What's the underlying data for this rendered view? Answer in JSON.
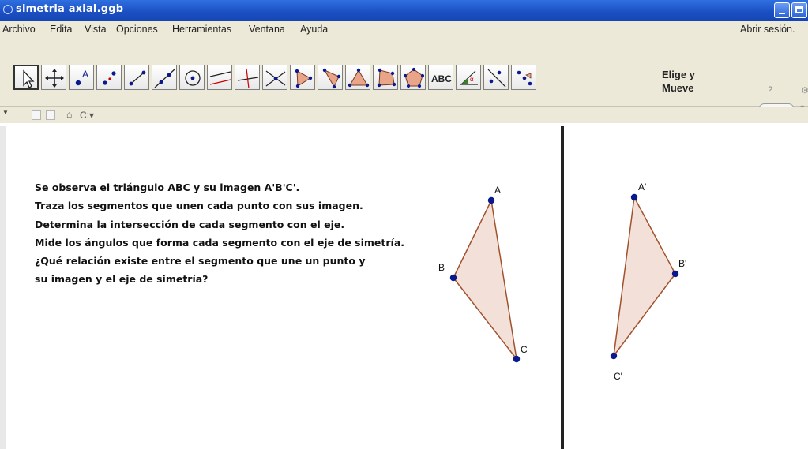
{
  "window": {
    "title": "simetria axial.ggb"
  },
  "menu": {
    "items": [
      "Archivo",
      "Edita",
      "Vista",
      "Opciones",
      "Herramientas",
      "Ventana",
      "Ayuda"
    ],
    "sign_in": "Abrir sesión."
  },
  "toolbar": {
    "tools": [
      {
        "name": "move-tool",
        "icon": "arrow-pointer-icon"
      },
      {
        "name": "move-graphics-view-tool",
        "icon": "four-arrows-icon"
      },
      {
        "name": "point-tool",
        "icon": "point-icon"
      },
      {
        "name": "point-pair-tool",
        "icon": "two-points-icon"
      },
      {
        "name": "segment-tool",
        "icon": "segment-icon"
      },
      {
        "name": "line-tool",
        "icon": "line-icon"
      },
      {
        "name": "circle-tool",
        "icon": "circle-center-icon"
      },
      {
        "name": "parallel-lines-tool",
        "icon": "parallel-lines-icon"
      },
      {
        "name": "perpendicular-line-tool",
        "icon": "perpendicular-icon"
      },
      {
        "name": "intersect-tool",
        "icon": "intersection-icon"
      },
      {
        "name": "polygon-tool",
        "icon": "polygon-icon"
      },
      {
        "name": "regular-polygon-tool",
        "icon": "regular-polygon-icon"
      },
      {
        "name": "rigid-polygon-tool",
        "icon": "rigid-polygon-icon"
      },
      {
        "name": "pentagon-tool",
        "icon": "pentagon-icon"
      },
      {
        "name": "text-tool",
        "icon": "text-abc-icon",
        "label": "ABC"
      },
      {
        "name": "angle-tool",
        "icon": "angle-icon"
      },
      {
        "name": "reflect-line-tool",
        "icon": "reflect-about-line-icon"
      },
      {
        "name": "reflect-point-tool",
        "icon": "reflect-about-point-icon"
      }
    ],
    "active_tool_line1": "Elige y",
    "active_tool_line2": "Mueve",
    "undo_icon": "undo-icon",
    "help_label": "?"
  },
  "stylebar": {
    "home_icon": "home-icon",
    "label": "C:▾"
  },
  "instructions": [
    "Se observa el triángulo ABC y su imagen A'B'C'.",
    "Traza los segmentos que unen cada punto con sus imagen.",
    "Determina la intersección de cada segmento con el eje.",
    "Mide los ángulos que forma cada segmento con el eje de simetría.",
    "¿Qué relación existe entre el segmento que une un punto y",
    "su imagen y el eje de simetría?"
  ],
  "construction": {
    "triangle_original": {
      "labels": [
        "A",
        "B",
        "C"
      ]
    },
    "triangle_image": {
      "labels": [
        "A'",
        "B'",
        "C'"
      ]
    },
    "fill": "#f2ddd4",
    "edge": "#a0522d",
    "point_color": "#0a1a8c"
  },
  "colors": {
    "titlebar": "#1b4fc2",
    "chrome": "#ece9d8"
  }
}
